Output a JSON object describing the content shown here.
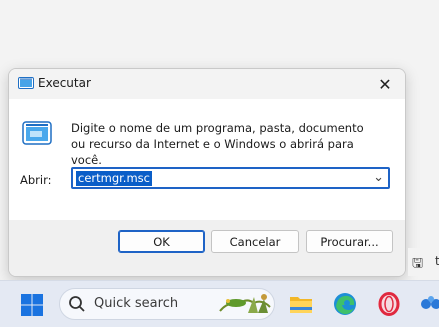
{
  "dialog": {
    "title": "Executar",
    "close_glyph": "✕",
    "description": "Digite o nome de um programa, pasta, documento ou recurso da Internet e o Windows o abrirá para você.",
    "open_label": "Abrir:",
    "open_value": "certmgr.msc",
    "dropdown_glyph": "⌄",
    "buttons": {
      "ok": "OK",
      "cancel": "Cancelar",
      "browse": "Procurar..."
    },
    "icons": [
      "run-icon",
      "close-icon",
      "chevron-down-icon"
    ]
  },
  "side_window": {
    "save_glyph": "🖫",
    "letter": "t"
  },
  "taskbar": {
    "search_placeholder": "Quick search",
    "icons": [
      "windows-start-icon",
      "search-icon",
      "file-explorer-icon",
      "edge-icon",
      "opera-icon",
      "app-icon"
    ]
  },
  "colors": {
    "accent": "#1e63c6",
    "selection": "#0a5ec8",
    "taskbar": "#e4e9f3"
  }
}
